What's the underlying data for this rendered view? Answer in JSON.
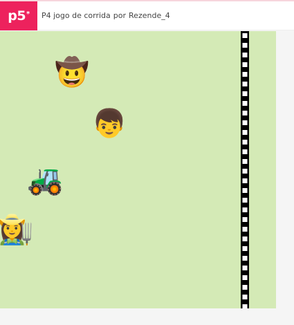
{
  "header": {
    "logo_text": "p5",
    "logo_mark": "*",
    "sketch_name": "P4 jogo de corrida",
    "by_label": "por",
    "author": "Rezende_4"
  },
  "colors": {
    "brand": "#ed225d",
    "canvas_bg": "#d4eab6",
    "page_bg": "#f5f5f5"
  },
  "game": {
    "runners": [
      {
        "icon": "cowboy-face-emoji",
        "glyph": "🤠"
      },
      {
        "icon": "boy-face-emoji",
        "glyph": "👦"
      },
      {
        "icon": "tractor-emoji",
        "glyph": "🚜"
      },
      {
        "icon": "woman-farmer-emoji",
        "glyph": "👩‍🌾"
      }
    ],
    "finish_line": "black-white-checkered"
  }
}
